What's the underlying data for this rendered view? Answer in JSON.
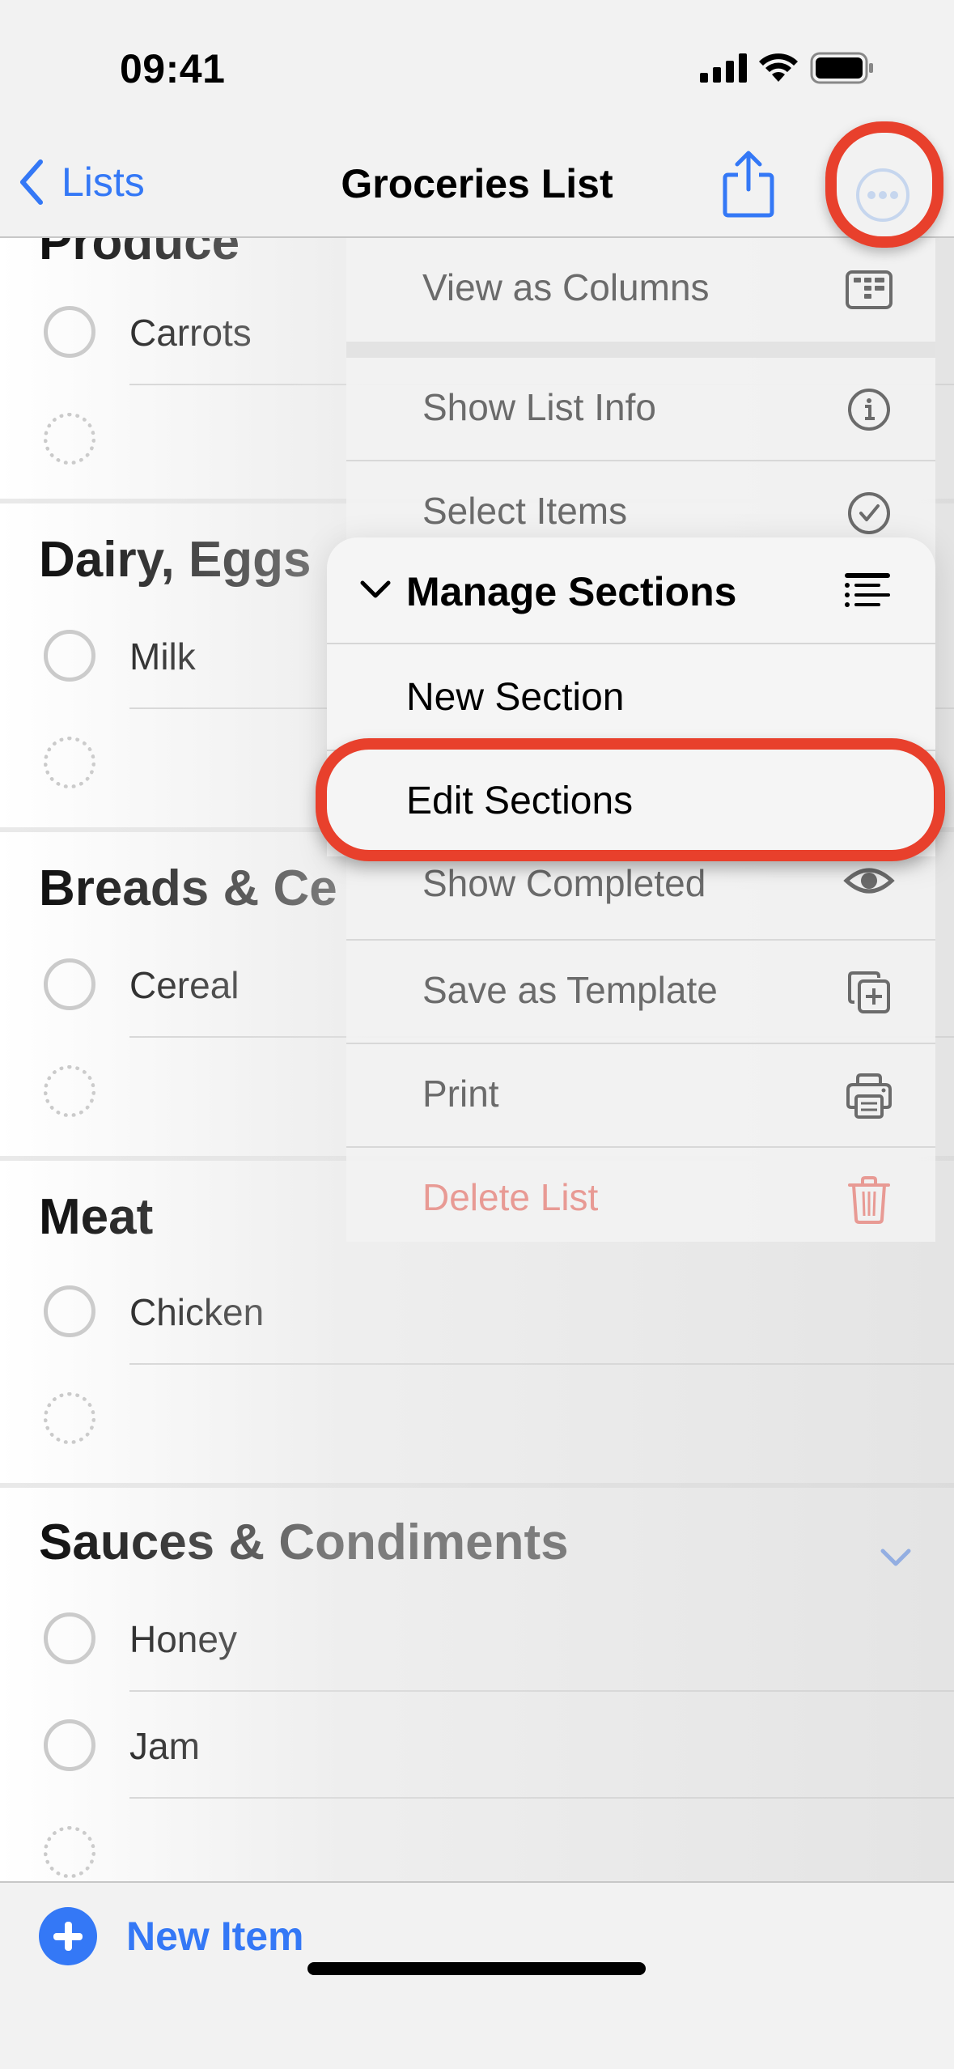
{
  "status_bar": {
    "time": "09:41",
    "icons": [
      "cellular-signal-icon",
      "wifi-icon",
      "battery-icon"
    ]
  },
  "nav": {
    "back_label": "Lists",
    "title": "Groceries List",
    "share_icon": "share-icon",
    "more_icon": "ellipsis-circle-icon"
  },
  "sections": [
    {
      "title": "Produce",
      "items": [
        "Carrots"
      ],
      "collapsed_chevron": false
    },
    {
      "title": "Dairy, Eggs",
      "items": [
        "Milk"
      ],
      "collapsed_chevron": false
    },
    {
      "title": "Breads & Ce",
      "items": [
        "Cereal"
      ],
      "collapsed_chevron": false
    },
    {
      "title": "Meat",
      "items": [
        "Chicken"
      ],
      "collapsed_chevron": false
    },
    {
      "title": "Sauces & Condiments",
      "items": [
        "Honey",
        "Jam"
      ],
      "collapsed_chevron": true
    }
  ],
  "menu": {
    "items": [
      {
        "label": "View as Columns",
        "icon": "columns-icon"
      },
      {
        "label": "Show List Info",
        "icon": "info-circle-icon"
      },
      {
        "label": "Select Items",
        "icon": "checkmark-circle-icon"
      },
      {
        "label": "Show Completed",
        "icon": "eye-icon"
      },
      {
        "label": "Save as Template",
        "icon": "template-plus-icon"
      },
      {
        "label": "Print",
        "icon": "printer-icon"
      },
      {
        "label": "Delete List",
        "icon": "trash-icon",
        "destructive": true
      }
    ],
    "submenu": {
      "header": "Manage Sections",
      "header_icon": "list-sections-icon",
      "items": [
        "New Section",
        "Edit Sections"
      ],
      "highlighted": "Edit Sections"
    }
  },
  "toolbar": {
    "new_item_label": "New Item"
  },
  "colors": {
    "accent": "#3478f6",
    "annotation": "#e8402c",
    "destructive": "#e89a94"
  }
}
